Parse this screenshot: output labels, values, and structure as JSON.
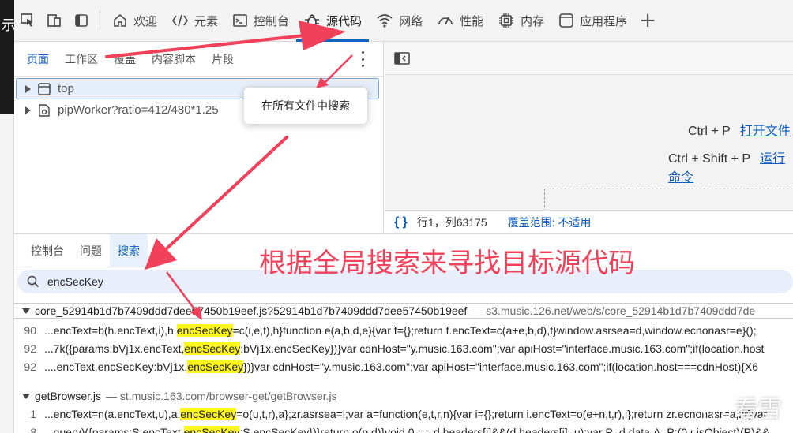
{
  "left_strip": {
    "glyph": "示"
  },
  "toolbar": {
    "tabs": [
      {
        "label": "欢迎",
        "icon": "home-icon"
      },
      {
        "label": "元素",
        "icon": "code-brackets-icon"
      },
      {
        "label": "控制台",
        "icon": "console-icon"
      },
      {
        "label": "源代码",
        "icon": "bug-icon",
        "active": true
      },
      {
        "label": "网络",
        "icon": "wifi-icon"
      },
      {
        "label": "性能",
        "icon": "gauge-icon"
      },
      {
        "label": "内存",
        "icon": "chip-icon"
      },
      {
        "label": "应用程序",
        "icon": "app-window-icon"
      }
    ],
    "more_label": "+"
  },
  "navigator": {
    "tabs": [
      "页面",
      "工作区",
      "覆盖",
      "内容脚本",
      "片段"
    ],
    "items": [
      {
        "label": "top",
        "icon": "frame-icon"
      },
      {
        "label": "pipWorker?ratio=412/480*1.25",
        "icon": "worker-gear-icon"
      }
    ],
    "popup_label": "在所有文件中搜索"
  },
  "editor": {
    "shortcuts": [
      {
        "keys": "Ctrl + P",
        "action": "打开文件"
      },
      {
        "keys": "Ctrl + Shift + P",
        "action": "运行命令"
      }
    ],
    "status": {
      "braces": "{ }",
      "position": "行1，列63175",
      "coverage": "覆盖范围: 不适用"
    }
  },
  "drawer": {
    "tabs": [
      "控制台",
      "问题",
      "搜索"
    ],
    "active_tab": "搜索",
    "search_query": "encSecKey",
    "results": [
      {
        "file": "core_52914b1d7b7409ddd7dee57450b19eef.js?52914b1d7b7409ddd7dee57450b19eef",
        "domain": "— s3.music.126.net/web/s/core_52914b1d7b7409ddd7de",
        "lines": [
          {
            "num": "90",
            "pre": "...encText=b(h.encText,i),h.",
            "match": "encSecKey",
            "post": "=c(i,e,f),h}function e(a,b,d,e){var f={};return f.encText=c(a+e,b,d),f}window.asrsea=d,window.ecnonasr=e}();"
          },
          {
            "num": "92",
            "pre": "...7k({params:bVj1x.encText,",
            "match": "encSecKey",
            "post": ":bVj1x.encSecKey})}var cdnHost=\"y.music.163.com\";var apiHost=\"interface.music.163.com\";if(location.host"
          },
          {
            "num": "92",
            "pre": "....encText,encSecKey:bVj1x.",
            "match": "encSecKey",
            "post": "})}var cdnHost=\"y.music.163.com\";var apiHost=\"interface.music.163.com\";if(location.host===cdnHost){X6"
          }
        ]
      },
      {
        "file": "getBrowser.js",
        "domain": "— st.music.163.com/browser-get/getBrowser.js",
        "lines": [
          {
            "num": "1",
            "pre": "...encText=n(a.encText,u),a.",
            "match": "encSecKey",
            "post": "=o(u,t,r),a};zr.asrsea=i;var a=function(e,t,r,n){var i={};return i.encText=o(e+n,t,r),i};return zr.ecnonasr=a,zr}var"
          },
          {
            "num": "8",
            "pre": "...query)({params:S.encText,",
            "match": "encSecKey",
            "post": ":S.encSecKey})}return o(p,d)}void 0===d.headers[i]&&(d.headers[i]=u);var P=d.data,A=P;(0,r.isObject)(P)&&"
          }
        ]
      }
    ]
  },
  "annotation": {
    "caption": "根据全局搜索来寻找目标源代码",
    "color": "#f0405a"
  },
  "watermark": {
    "text": "看雪"
  }
}
